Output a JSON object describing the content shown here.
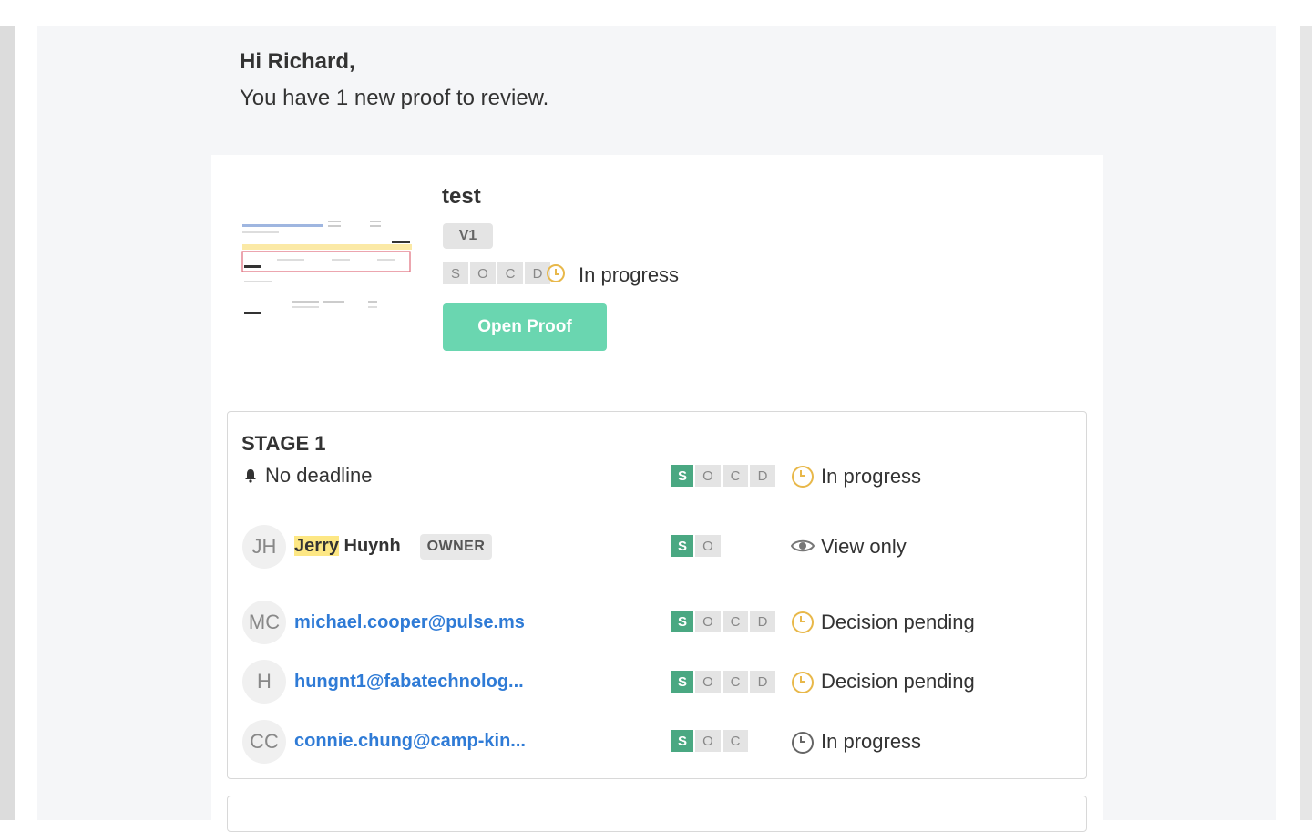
{
  "greeting": {
    "name_line": "Hi Richard,",
    "message": "You have 1 new proof to review."
  },
  "proof": {
    "title": "test",
    "version": "V1",
    "steps": [
      "S",
      "O",
      "C",
      "D"
    ],
    "status": "In progress",
    "open_button": "Open Proof"
  },
  "stage": {
    "title": "STAGE 1",
    "deadline": "No deadline",
    "steps": [
      "S",
      "O",
      "C",
      "D"
    ],
    "status": "In progress",
    "reviewers": [
      {
        "initials": "JH",
        "first_name": "Jerry",
        "last_name": " Huynh",
        "badge": "OWNER",
        "steps": [
          "S",
          "O"
        ],
        "status": "View only"
      },
      {
        "initials": "MC",
        "email": "michael.cooper@pulse.ms",
        "steps": [
          "S",
          "O",
          "C",
          "D"
        ],
        "status": "Decision pending"
      },
      {
        "initials": "H",
        "email": "hungnt1@fabatechnolog...",
        "steps": [
          "S",
          "O",
          "C",
          "D"
        ],
        "status": "Decision pending"
      },
      {
        "initials": "CC",
        "email": "connie.chung@camp-kin...",
        "steps": [
          "S",
          "O",
          "C"
        ],
        "status": "In progress"
      }
    ]
  },
  "colors": {
    "accent_green": "#4aa882",
    "button_green": "#6ad6b0",
    "pending_yellow": "#e8b84a",
    "link_blue": "#2f7bd6",
    "highlight": "#fde784"
  }
}
